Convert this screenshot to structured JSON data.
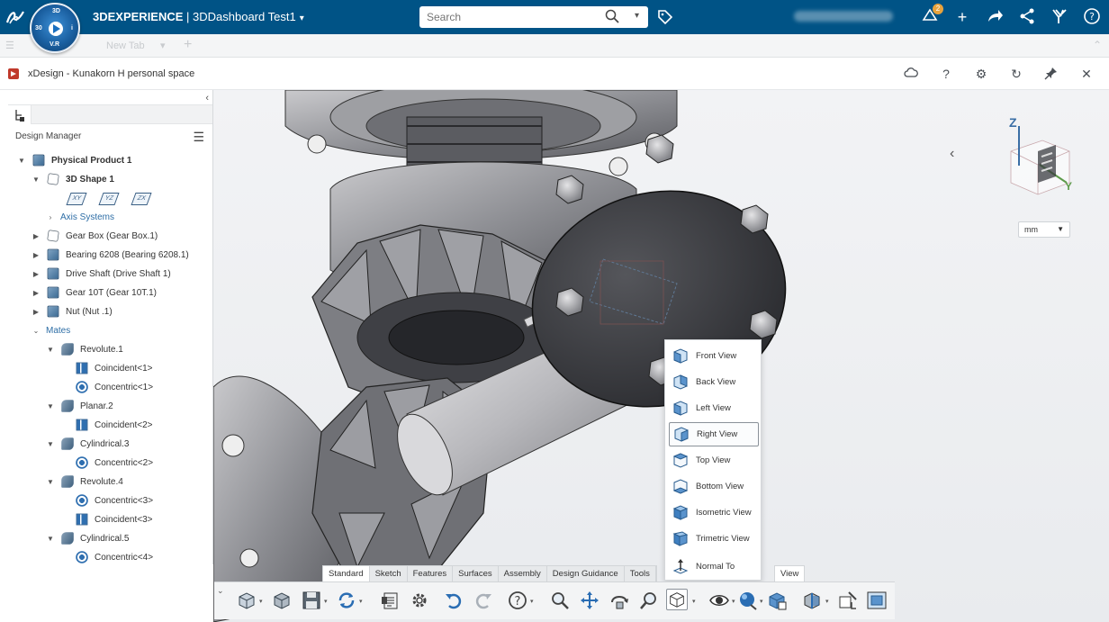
{
  "topbar": {
    "brand_strong": "3DEXPERIENCE",
    "brand_rest": " | 3DDashboard  Test1",
    "search_placeholder": "Search",
    "notification_count": "2",
    "compass": {
      "top": "3D",
      "left": "30",
      "right": "i",
      "bottom": "V.R"
    }
  },
  "tabbar": {
    "new_tab": "New Tab"
  },
  "app": {
    "title": "xDesign - Kunakorn H personal space"
  },
  "panel": {
    "title": "Design Manager",
    "tree": [
      {
        "label": "Physical Product 1",
        "icon": "product-icon"
      },
      {
        "label": "3D Shape 1",
        "icon": "shape-icon"
      },
      {
        "label": "Axis Systems",
        "icon": ""
      },
      {
        "label": "Gear Box (Gear Box.1)",
        "icon": "part-icon"
      },
      {
        "label": "Bearing 6208 (Bearing 6208.1)",
        "icon": "part-icon"
      },
      {
        "label": "Drive Shaft (Drive Shaft 1)",
        "icon": "part-icon"
      },
      {
        "label": "Gear 10T (Gear 10T.1)",
        "icon": "part-icon"
      },
      {
        "label": "Nut  (Nut .1)",
        "icon": "part-icon"
      },
      {
        "label": "Mates",
        "icon": ""
      },
      {
        "label": "Revolute.1",
        "icon": "revolute-icon"
      },
      {
        "label": "Coincident<1>",
        "icon": "coincident-icon"
      },
      {
        "label": "Concentric<1>",
        "icon": "concentric-icon"
      },
      {
        "label": "Planar.2",
        "icon": "planar-icon"
      },
      {
        "label": "Coincident<2>",
        "icon": "coincident-icon"
      },
      {
        "label": "Cylindrical.3",
        "icon": "cylindrical-icon"
      },
      {
        "label": "Concentric<2>",
        "icon": "concentric-icon"
      },
      {
        "label": "Revolute.4",
        "icon": "revolute-icon"
      },
      {
        "label": "Concentric<3>",
        "icon": "concentric-icon"
      },
      {
        "label": "Coincident<3>",
        "icon": "coincident-icon"
      },
      {
        "label": "Cylindrical.5",
        "icon": "cylindrical-icon"
      },
      {
        "label": "Concentric<4>",
        "icon": "concentric-icon"
      }
    ],
    "planes": [
      "XY",
      "YZ",
      "ZX"
    ]
  },
  "viewport": {
    "units": "mm",
    "axis_z": "Z",
    "axis_y": "Y"
  },
  "view_menu": {
    "items": [
      "Front View",
      "Back View",
      "Left View",
      "Right View",
      "Top View",
      "Bottom View",
      "Isometric View",
      "Trimetric View",
      "Normal To"
    ],
    "selected": "Right View"
  },
  "toolbar": {
    "tabs": [
      "Standard",
      "Sketch",
      "Features",
      "Surfaces",
      "Assembly",
      "Design Guidance",
      "Tools"
    ],
    "active_tab": "Standard",
    "view_tab": "View",
    "tools": [
      "insert-icon",
      "part-icon",
      "save-icon",
      "sync-icon",
      "clipboard-icon",
      "settings-icon",
      "undo-icon",
      "redo-icon",
      "help-icon",
      "zoom-icon",
      "pan-icon",
      "rotate-icon",
      "zoom-fit-icon",
      "view-orientation-icon",
      "visibility-icon",
      "appearance-icon",
      "render-icon",
      "section-icon",
      "measure-icon",
      "screen-capture-icon"
    ]
  },
  "colors": {
    "topbar": "#005386",
    "accent": "#2f6fb0"
  }
}
